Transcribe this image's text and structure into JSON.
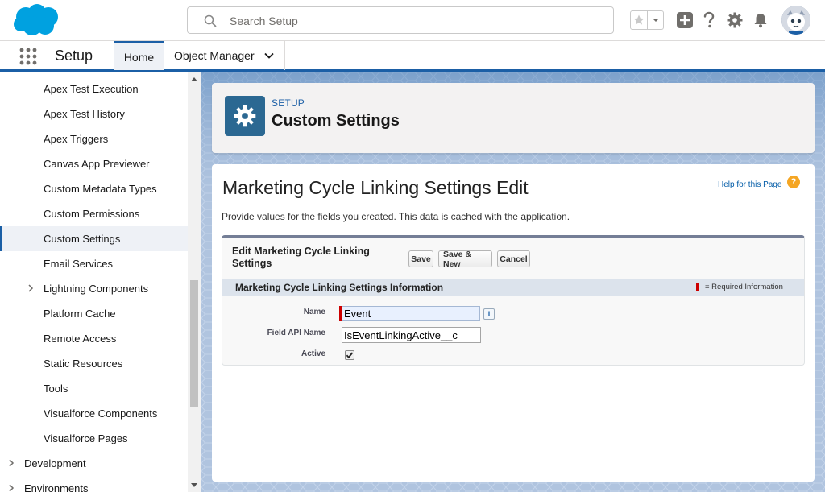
{
  "header": {
    "search_placeholder": "Search Setup",
    "icons": [
      "salesforce-cloud-logo",
      "search-icon",
      "star-icon",
      "chevron-down-icon",
      "plus-icon",
      "help-icon",
      "gear-icon",
      "bell-icon",
      "avatar"
    ]
  },
  "context_bar": {
    "app_name": "Setup",
    "tabs": [
      {
        "label": "Home"
      },
      {
        "label": "Object Manager"
      }
    ]
  },
  "sidebar": {
    "items": [
      {
        "label": "Apex Test Execution"
      },
      {
        "label": "Apex Test History"
      },
      {
        "label": "Apex Triggers"
      },
      {
        "label": "Canvas App Previewer"
      },
      {
        "label": "Custom Metadata Types"
      },
      {
        "label": "Custom Permissions"
      },
      {
        "label": "Custom Settings"
      },
      {
        "label": "Email Services"
      },
      {
        "label": "Lightning Components"
      },
      {
        "label": "Platform Cache"
      },
      {
        "label": "Remote Access"
      },
      {
        "label": "Static Resources"
      },
      {
        "label": "Tools"
      },
      {
        "label": "Visualforce Components"
      },
      {
        "label": "Visualforce Pages"
      },
      {
        "label": "Development"
      },
      {
        "label": "Environments"
      }
    ],
    "active_item": "Custom Settings"
  },
  "page_header": {
    "breadcrumb": "SETUP",
    "title": "Custom Settings"
  },
  "content": {
    "title": "Marketing Cycle Linking Settings Edit",
    "help_link": "Help for this Page",
    "description": "Provide values for the fields you created. This data is cached with the application.",
    "edit_block": {
      "title": "Edit Marketing Cycle Linking Settings",
      "buttons": {
        "save": "Save",
        "save_new": "Save & New",
        "cancel": "Cancel"
      },
      "section_title": "Marketing Cycle Linking Settings Information",
      "required_legend": "= Required Information",
      "fields": {
        "name_label": "Name",
        "name_value": "Event",
        "api_label": "Field API Name",
        "api_value": "IsEventLinkingActive__c",
        "active_label": "Active",
        "active_checked": true
      },
      "info_glyph": "i"
    }
  },
  "colors": {
    "brand_blue": "#1b5fa6",
    "header_icon_bg": "#2b6892",
    "required_red": "#cc0000",
    "background_blue": "#b0c4df"
  }
}
